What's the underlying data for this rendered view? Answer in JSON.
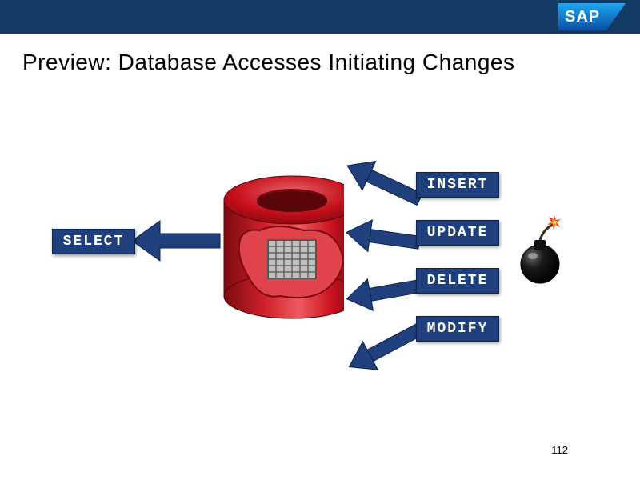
{
  "brand": {
    "text": "SAP"
  },
  "title": "Preview: Database Accesses Initiating Changes",
  "ops": {
    "select": "SELECT",
    "insert": "INSERT",
    "update": "UPDATE",
    "delete": "DELETE",
    "modify": "MODIFY"
  },
  "colors": {
    "navy": "#1f3f7d",
    "headerBar": "#123a64",
    "dbRed": "#c70f1a",
    "dbRedDark": "#8e0a12"
  },
  "slide_number": "112"
}
